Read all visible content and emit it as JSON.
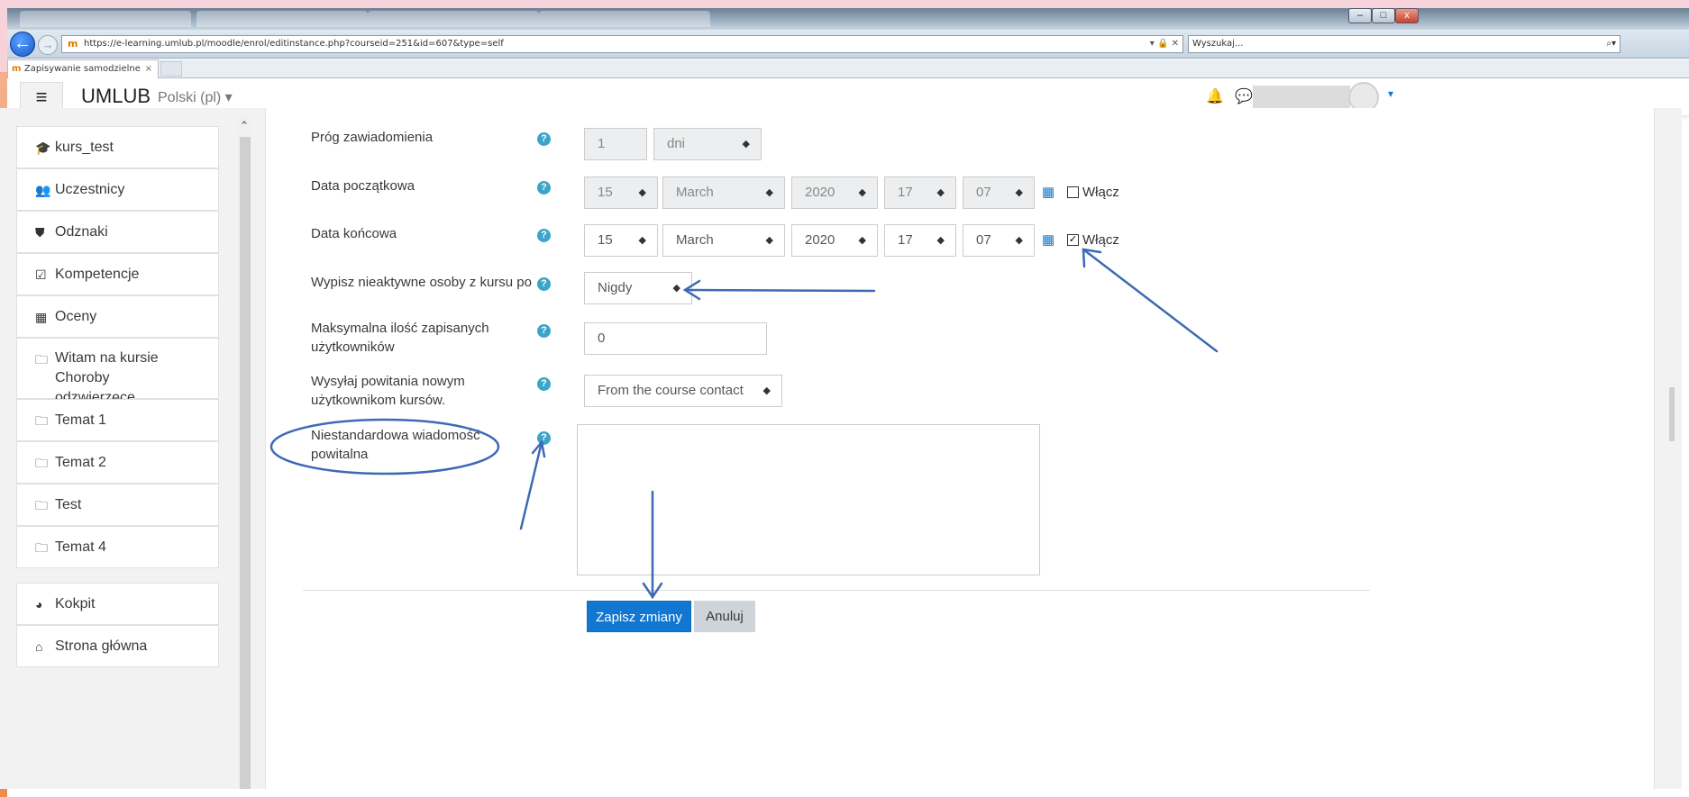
{
  "browser": {
    "url": "https://e-learning.umlub.pl/moodle/enrol/editinstance.php?courseid=251&id=607&type=self",
    "search_placeholder": "Wyszukaj...",
    "tab_title": "Zapisywanie samodzielne",
    "tab_close": "×"
  },
  "header": {
    "menu_icon": "≡",
    "brand": "UMLUB",
    "language": "Polski (pl) ▾"
  },
  "sidebar": {
    "items": [
      {
        "icon": "graduation-cap",
        "glyph": "🎓",
        "label": "kurs_test"
      },
      {
        "icon": "users",
        "glyph": "👥",
        "label": "Uczestnicy"
      },
      {
        "icon": "shield",
        "glyph": "⛊",
        "label": "Odznaki"
      },
      {
        "icon": "check-square",
        "glyph": "☑",
        "label": "Kompetencje"
      },
      {
        "icon": "table",
        "glyph": "▦",
        "label": "Oceny"
      },
      {
        "icon": "folder",
        "glyph": "🗀",
        "label": "Witam na kursie Choroby odzwierzęce"
      },
      {
        "icon": "folder",
        "glyph": "🗀",
        "label": "Temat 1"
      },
      {
        "icon": "folder",
        "glyph": "🗀",
        "label": "Temat 2"
      },
      {
        "icon": "folder",
        "glyph": "🗀",
        "label": "Test"
      },
      {
        "icon": "folder",
        "glyph": "🗀",
        "label": "Temat 4"
      },
      {
        "icon": "dashboard",
        "glyph": "◕",
        "label": "Kokpit"
      },
      {
        "icon": "home",
        "glyph": "⌂",
        "label": "Strona główna"
      }
    ]
  },
  "form": {
    "notify_threshold": {
      "label": "Próg zawiadomienia",
      "value": "1",
      "unit": "dni"
    },
    "start_date": {
      "label": "Data początkowa",
      "day": "15",
      "month": "March",
      "year": "2020",
      "hour": "17",
      "minute": "07",
      "enable_label": "Włącz",
      "enabled": false
    },
    "end_date": {
      "label": "Data końcowa",
      "day": "15",
      "month": "March",
      "year": "2020",
      "hour": "17",
      "minute": "07",
      "enable_label": "Włącz",
      "enabled": true
    },
    "unenrol_inactive": {
      "label": "Wypisz nieaktywne osoby z kursu po",
      "value": "Nigdy"
    },
    "max_enrolled": {
      "label_line1": "Maksymalna ilość zapisanych",
      "label_line2": "użytkowników",
      "value": "0"
    },
    "send_welcome": {
      "label_line1": "Wysyłaj powitania nowym",
      "label_line2": "użytkownikom kursów.",
      "value": "From the course contact"
    },
    "custom_welcome": {
      "label_line1": "Niestandardowa wiadomość",
      "label_line2": "powitalna",
      "value": ""
    },
    "save_label": "Zapisz zmiany",
    "cancel_label": "Anuluj",
    "help_glyph": "?"
  },
  "annotations": {
    "color": "#3d6ab3"
  }
}
